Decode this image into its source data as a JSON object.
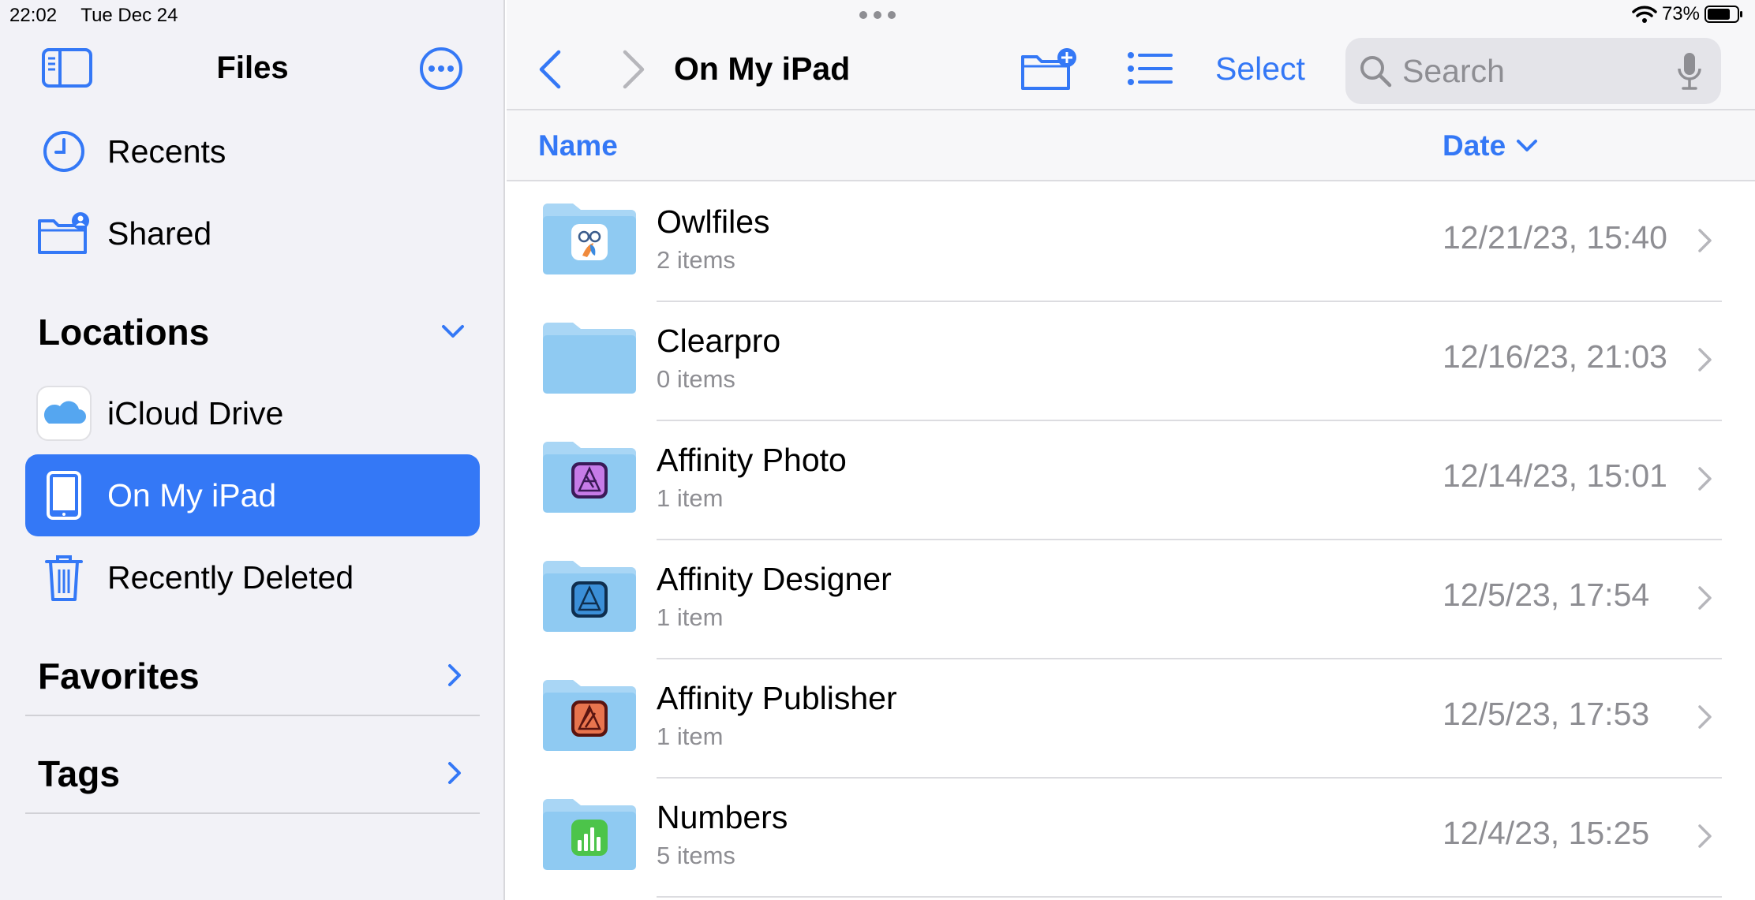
{
  "status": {
    "time": "22:02",
    "date": "Tue Dec 24",
    "battery": "73%"
  },
  "sidebar": {
    "title": "Files",
    "top_items": [
      {
        "label": "Recents",
        "icon": "clock-icon"
      },
      {
        "label": "Shared",
        "icon": "shared-folder-icon"
      }
    ],
    "locations_title": "Locations",
    "locations": [
      {
        "label": "iCloud Drive",
        "icon": "icloud-icon",
        "active": false
      },
      {
        "label": "On My iPad",
        "icon": "ipad-icon",
        "active": true
      },
      {
        "label": "Recently Deleted",
        "icon": "trash-icon",
        "active": false
      }
    ],
    "favorites_title": "Favorites",
    "tags_title": "Tags"
  },
  "toolbar": {
    "title": "On My iPad",
    "select_label": "Select",
    "search_placeholder": "Search"
  },
  "columns": {
    "name": "Name",
    "date": "Date"
  },
  "files": [
    {
      "name": "Owlfiles",
      "count": "2 items",
      "date": "12/21/23, 15:40",
      "badge": "owlfiles"
    },
    {
      "name": "Clearpro",
      "count": "0 items",
      "date": "12/16/23, 21:03",
      "badge": "none"
    },
    {
      "name": "Affinity Photo",
      "count": "1 item",
      "date": "12/14/23, 15:01",
      "badge": "affinity-photo"
    },
    {
      "name": "Affinity Designer",
      "count": "1 item",
      "date": "12/5/23, 17:54",
      "badge": "affinity-designer"
    },
    {
      "name": "Affinity Publisher",
      "count": "1 item",
      "date": "12/5/23, 17:53",
      "badge": "affinity-publisher"
    },
    {
      "name": "Numbers",
      "count": "5 items",
      "date": "12/4/23, 15:25",
      "badge": "numbers"
    }
  ],
  "colors": {
    "accent": "#3478f6",
    "folder": "#8fcaf2",
    "folder_tab": "#a9d6f5",
    "secondary_text": "#8e8e93"
  }
}
